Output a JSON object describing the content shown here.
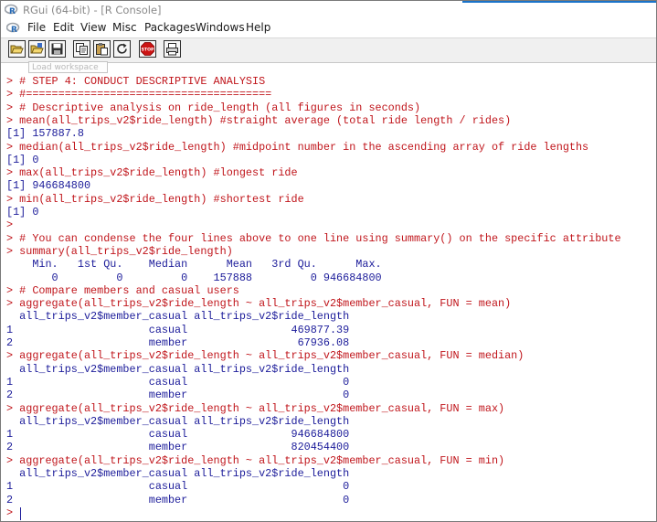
{
  "window": {
    "title": "RGui (64-bit) - [R Console]",
    "accent_color": "#1a73c9"
  },
  "menubar": {
    "app_icon": "r-logo-icon",
    "items": [
      "File",
      "Edit",
      "View",
      "Misc",
      "Packages",
      "Windows",
      "Help"
    ]
  },
  "toolbar": {
    "buttons": [
      {
        "icon": "open-script-icon"
      },
      {
        "icon": "load-workspace-icon"
      },
      {
        "icon": "save-workspace-icon"
      },
      {
        "icon": "copy-icon"
      },
      {
        "icon": "paste-icon"
      },
      {
        "icon": "copy-paste-icon"
      },
      {
        "icon": "stop-icon",
        "label": "STOP"
      },
      {
        "icon": "print-icon"
      }
    ],
    "tooltip": "Load workspace"
  },
  "console": {
    "input_color": "#c0151b",
    "output_color": "#1c1c9a",
    "lines": [
      {
        "type": "in",
        "text": "> # STEP 4: CONDUCT DESCRIPTIVE ANALYSIS"
      },
      {
        "type": "in",
        "text": "> #======================================"
      },
      {
        "type": "in",
        "text": "> # Descriptive analysis on ride_length (all figures in seconds)"
      },
      {
        "type": "in",
        "text": "> mean(all_trips_v2$ride_length) #straight average (total ride length / rides)"
      },
      {
        "type": "out",
        "text": "[1] 157887.8"
      },
      {
        "type": "in",
        "text": "> median(all_trips_v2$ride_length) #midpoint number in the ascending array of ride lengths"
      },
      {
        "type": "out",
        "text": "[1] 0"
      },
      {
        "type": "in",
        "text": "> max(all_trips_v2$ride_length) #longest ride"
      },
      {
        "type": "out",
        "text": "[1] 946684800"
      },
      {
        "type": "in",
        "text": "> min(all_trips_v2$ride_length) #shortest ride"
      },
      {
        "type": "out",
        "text": "[1] 0"
      },
      {
        "type": "in",
        "text": ">"
      },
      {
        "type": "in",
        "text": "> # You can condense the four lines above to one line using summary() on the specific attribute"
      },
      {
        "type": "in",
        "text": "> summary(all_trips_v2$ride_length)"
      },
      {
        "type": "out",
        "text": "    Min.   1st Qu.    Median      Mean   3rd Qu.      Max."
      },
      {
        "type": "out",
        "text": "       0         0         0    157888         0 946684800"
      },
      {
        "type": "in",
        "text": "> # Compare members and casual users"
      },
      {
        "type": "in",
        "text": "> aggregate(all_trips_v2$ride_length ~ all_trips_v2$member_casual, FUN = mean)"
      },
      {
        "type": "out",
        "text": "  all_trips_v2$member_casual all_trips_v2$ride_length"
      },
      {
        "type": "out",
        "text": "1                     casual                469877.39"
      },
      {
        "type": "out",
        "text": "2                     member                 67936.08"
      },
      {
        "type": "in",
        "text": "> aggregate(all_trips_v2$ride_length ~ all_trips_v2$member_casual, FUN = median)"
      },
      {
        "type": "out",
        "text": "  all_trips_v2$member_casual all_trips_v2$ride_length"
      },
      {
        "type": "out",
        "text": "1                     casual                        0"
      },
      {
        "type": "out",
        "text": "2                     member                        0"
      },
      {
        "type": "in",
        "text": "> aggregate(all_trips_v2$ride_length ~ all_trips_v2$member_casual, FUN = max)"
      },
      {
        "type": "out",
        "text": "  all_trips_v2$member_casual all_trips_v2$ride_length"
      },
      {
        "type": "out",
        "text": "1                     casual                946684800"
      },
      {
        "type": "out",
        "text": "2                     member                820454400"
      },
      {
        "type": "in",
        "text": "> aggregate(all_trips_v2$ride_length ~ all_trips_v2$member_casual, FUN = min)"
      },
      {
        "type": "out",
        "text": "  all_trips_v2$member_casual all_trips_v2$ride_length"
      },
      {
        "type": "out",
        "text": "1                     casual                        0"
      },
      {
        "type": "out",
        "text": "2                     member                        0"
      },
      {
        "type": "in",
        "text": ">"
      }
    ]
  }
}
